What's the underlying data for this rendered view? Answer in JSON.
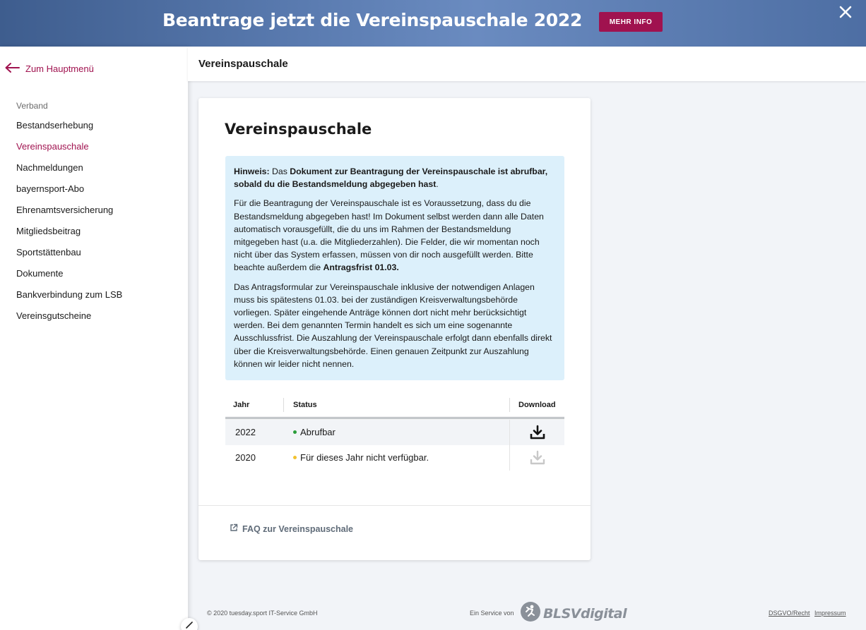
{
  "banner": {
    "title": "Beantrage jetzt die Vereinspauschale 2022",
    "button_label": "MEHR INFO",
    "close_glyph": "✕",
    "bg_color": "#4d6ea3",
    "button_color": "#a0124f"
  },
  "sidebar": {
    "back_label": "Zum Hauptmenü",
    "back_icon": "arrow-left-icon",
    "heading": "Verband",
    "items": [
      {
        "label": "Bestandserhebung"
      },
      {
        "label": "Vereinspauschale",
        "active": true
      },
      {
        "label": "Nachmeldungen"
      },
      {
        "label": "bayernsport-Abo"
      },
      {
        "label": "Ehrenamtsversicherung"
      },
      {
        "label": "Mitgliedsbeitrag"
      },
      {
        "label": "Sportstättenbau"
      },
      {
        "label": "Dokumente"
      },
      {
        "label": "Bankverbindung zum LSB"
      },
      {
        "label": "Vereinsgutscheine"
      }
    ],
    "accent_color": "#a0124f"
  },
  "header": {
    "title": "Vereinspauschale"
  },
  "card": {
    "title": "Vereinspauschale",
    "notice": {
      "p1_label": "Hinweis:",
      "p1_text": " Das ",
      "p1_bold": "Dokument zur Beantragung der Vereinspauschale ist abrufbar, sobald du die Bestandsmeldung abgegeben hast",
      "p1_end": ".",
      "p2_text": "Für die Beantragung der Vereinspauschale ist es Voraussetzung, dass du die Bestandsmeldung abgegeben hast! Im Dokument selbst werden dann alle Daten automatisch vorausgefüllt, die du uns im Rahmen der Bestandsmeldung mitgegeben hast (u.a. die Mitgliederzahlen). Die Felder, die wir momentan noch nicht über das System erfassen, müssen von dir noch ausgefüllt werden. Bitte beachte außerdem die ",
      "p2_bold": "Antragsfrist 01.03.",
      "p3_text": "Das Antragsformular zur Vereinspauschale inklusive der notwendigen Anlagen muss bis spätestens 01.03. bei der zuständigen Kreisverwaltungsbehörde vorliegen. Später eingehende Anträge können dort nicht mehr berücksichtigt werden. Bei dem genannten Termin handelt es sich um eine sogenannte Ausschlussfrist. Die Auszahlung der Vereinspauschale erfolgt dann ebenfalls direkt über die Kreisverwaltungsbehörde. Einen genauen Zeitpunkt zur Auszahlung können wir leider nicht nennen."
    },
    "table": {
      "headers": {
        "year": "Jahr",
        "status": "Status",
        "download": "Download"
      },
      "rows": [
        {
          "year": "2022",
          "status": "Abrufbar",
          "status_color": "#2a9d3a",
          "download_enabled": true
        },
        {
          "year": "2020",
          "status": "Für dieses Jahr nicht verfügbar.",
          "status_color": "#f2c230",
          "download_enabled": false
        }
      ]
    },
    "faq_label": "FAQ zur Vereinspauschale",
    "faq_icon": "external-link-icon"
  },
  "footer": {
    "copyright": "© 2020 tuesday.sport IT-Service GmbH",
    "service_label": "Ein Service von",
    "logo_text": "BLSVdigital",
    "link_privacy": "DSGVO/Recht",
    "link_imprint": "Impressum"
  }
}
